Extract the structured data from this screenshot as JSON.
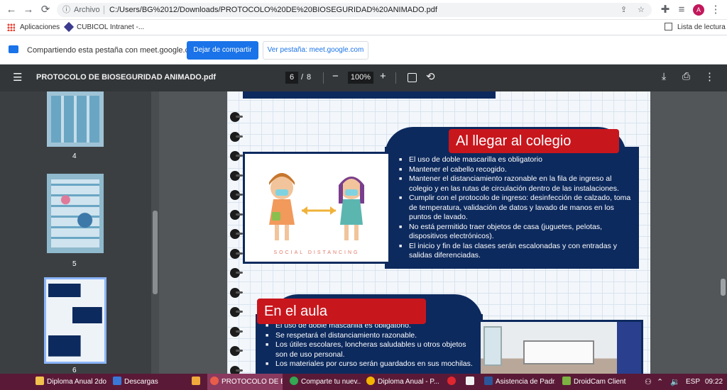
{
  "browser": {
    "address": {
      "label": "Archivo",
      "url": "C:/Users/BG%2012/Downloads/PROTOCOLO%20DE%20BIOSEGURIDAD%20ANIMADO.pdf"
    },
    "profile_initial": "A",
    "bookmarks": {
      "apps": "Aplicaciones",
      "cubicol": "CUBICOL Intranet -...",
      "reading_list": "Lista de lectura"
    }
  },
  "share_bar": {
    "message": "Compartiendo esta pestaña con meet.google.com",
    "stop_label": "Dejar de compartir",
    "view_label": "Ver pestaña: meet.google.com"
  },
  "pdf": {
    "title": "PROTOCOLO DE BIOSEGURIDAD ANIMADO.pdf",
    "current_page": "6",
    "separator": "/",
    "total_pages": "8",
    "zoom": "100%"
  },
  "thumbnails": [
    {
      "number": "4"
    },
    {
      "number": "5"
    },
    {
      "number": "6"
    }
  ],
  "page_content": {
    "section1": {
      "heading": "Al llegar al colegio",
      "image_caption": "SOCIAL DISTANCING",
      "bullets": [
        "El uso de doble mascarilla es obligatorio",
        "Mantener el cabello recogido.",
        "Mantener el distanciamiento razonable en la fila de ingreso al colegio y en las rutas de circulación dentro de las instalaciones.",
        "Cumplir con el protocolo de ingreso: desinfección de calzado, toma de temperatura, validación de datos y lavado de manos en los puntos de lavado.",
        "No está permitido traer objetos de casa (juguetes, pelotas, dispositivos electrónicos).",
        "El inicio y fin de las clases serán escalonadas y con entradas y salidas diferenciadas."
      ]
    },
    "section2": {
      "heading": "En el aula",
      "bullets": [
        "El uso de doble mascarilla es obligatorio.",
        "Se respetará el distanciamiento razonable.",
        "Los útiles escolares, loncheras saludables u otros objetos son de uso personal.",
        "Los materiales por curso serán guardados en sus mochilas."
      ]
    }
  },
  "taskbar": {
    "items": [
      "Diploma Anual 2do...",
      "Descargas",
      "",
      "PROTOCOLO DE BI...",
      "Comparte tu nuev...",
      "Diploma Anual - P...",
      "",
      "",
      "Asistencia de Padr...",
      "DroidCam Client"
    ],
    "lang": "ESP",
    "time": "09:22"
  }
}
